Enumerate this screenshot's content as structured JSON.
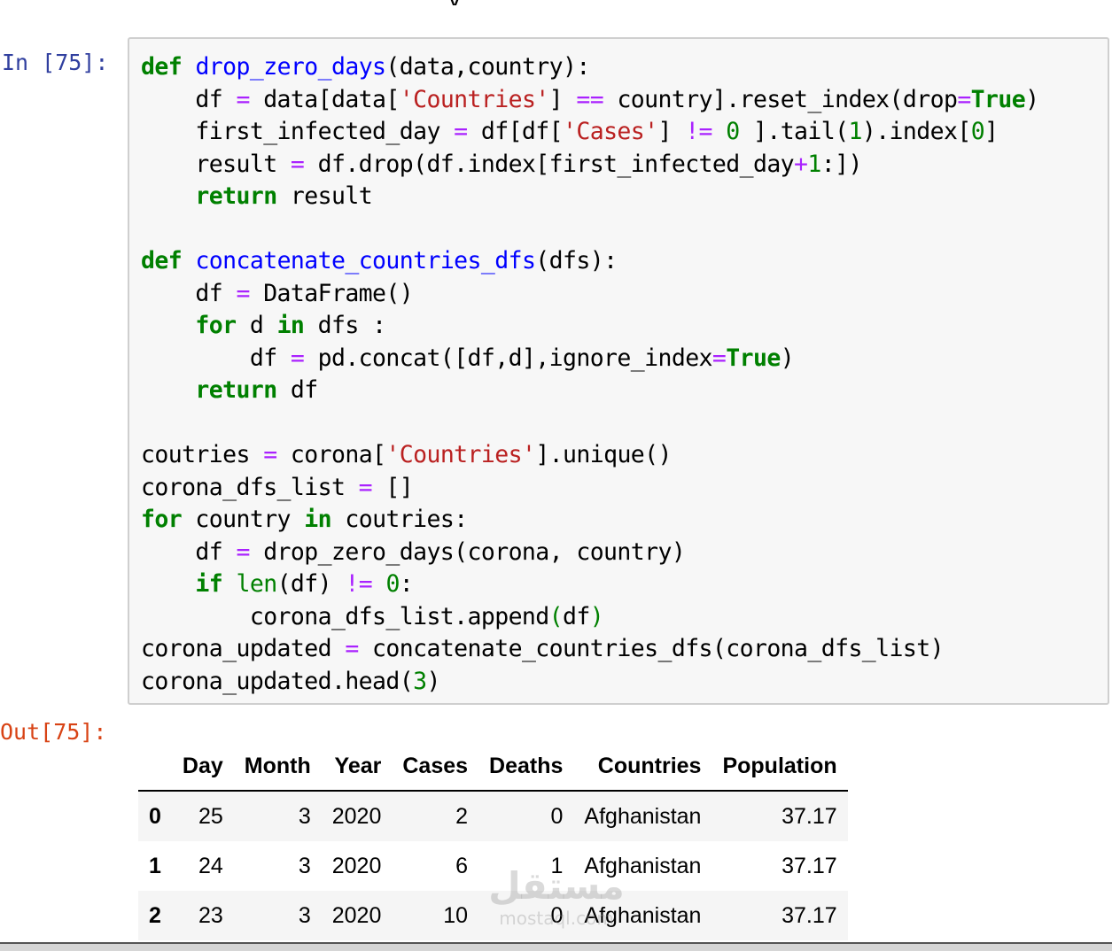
{
  "input_prompt": "In [75]:",
  "output_prompt": "Out[75]:",
  "code_lines": [
    [
      [
        "kw",
        "def"
      ],
      [
        "t",
        " "
      ],
      [
        "fn",
        "drop_zero_days"
      ],
      [
        "t",
        "(data,country):"
      ]
    ],
    [
      [
        "t",
        "    df "
      ],
      [
        "op",
        "="
      ],
      [
        "t",
        " data[data["
      ],
      [
        "str",
        "'Countries'"
      ],
      [
        "t",
        "] "
      ],
      [
        "op",
        "=="
      ],
      [
        "t",
        " country].reset_index(drop"
      ],
      [
        "op",
        "="
      ],
      [
        "kw",
        "True"
      ],
      [
        "t",
        ")"
      ]
    ],
    [
      [
        "t",
        "    first_infected_day "
      ],
      [
        "op",
        "="
      ],
      [
        "t",
        " df[df["
      ],
      [
        "str",
        "'Cases'"
      ],
      [
        "t",
        "] "
      ],
      [
        "op",
        "!="
      ],
      [
        "t",
        " "
      ],
      [
        "num",
        "0"
      ],
      [
        "t",
        " ].tail("
      ],
      [
        "num",
        "1"
      ],
      [
        "t",
        ").index["
      ],
      [
        "num",
        "0"
      ],
      [
        "t",
        "]"
      ]
    ],
    [
      [
        "t",
        "    result "
      ],
      [
        "op",
        "="
      ],
      [
        "t",
        " df.drop(df.index[first_infected_day"
      ],
      [
        "op",
        "+"
      ],
      [
        "num",
        "1"
      ],
      [
        "t",
        ":])"
      ]
    ],
    [
      [
        "t",
        "    "
      ],
      [
        "kw",
        "return"
      ],
      [
        "t",
        " result"
      ]
    ],
    [
      [
        "t",
        ""
      ]
    ],
    [
      [
        "kw",
        "def"
      ],
      [
        "t",
        " "
      ],
      [
        "fn",
        "concatenate_countries_dfs"
      ],
      [
        "t",
        "(dfs):"
      ]
    ],
    [
      [
        "t",
        "    df "
      ],
      [
        "op",
        "="
      ],
      [
        "t",
        " DataFrame()"
      ]
    ],
    [
      [
        "t",
        "    "
      ],
      [
        "kw",
        "for"
      ],
      [
        "t",
        " d "
      ],
      [
        "kw",
        "in"
      ],
      [
        "t",
        " dfs :"
      ]
    ],
    [
      [
        "t",
        "        df "
      ],
      [
        "op",
        "="
      ],
      [
        "t",
        " pd.concat([df,d],ignore_index"
      ],
      [
        "op",
        "="
      ],
      [
        "kw",
        "True"
      ],
      [
        "t",
        ")"
      ]
    ],
    [
      [
        "t",
        "    "
      ],
      [
        "kw",
        "return"
      ],
      [
        "t",
        " df"
      ]
    ],
    [
      [
        "t",
        ""
      ]
    ],
    [
      [
        "t",
        "coutries "
      ],
      [
        "op",
        "="
      ],
      [
        "t",
        " corona["
      ],
      [
        "str",
        "'Countries'"
      ],
      [
        "t",
        "].unique()"
      ]
    ],
    [
      [
        "t",
        "corona_dfs_list "
      ],
      [
        "op",
        "="
      ],
      [
        "t",
        " []"
      ]
    ],
    [
      [
        "kw",
        "for"
      ],
      [
        "t",
        " country "
      ],
      [
        "kw",
        "in"
      ],
      [
        "t",
        " coutries:"
      ]
    ],
    [
      [
        "t",
        "    df "
      ],
      [
        "op",
        "="
      ],
      [
        "t",
        " drop_zero_days(corona, country)"
      ]
    ],
    [
      [
        "t",
        "    "
      ],
      [
        "kw",
        "if"
      ],
      [
        "t",
        " "
      ],
      [
        "bi",
        "len"
      ],
      [
        "t",
        "(df) "
      ],
      [
        "op",
        "!="
      ],
      [
        "t",
        " "
      ],
      [
        "num",
        "0"
      ],
      [
        "t",
        ":"
      ]
    ],
    [
      [
        "t",
        "        corona_dfs_list.append"
      ],
      [
        "num",
        "("
      ],
      [
        "t",
        "df"
      ],
      [
        "num",
        ")"
      ]
    ],
    [
      [
        "t",
        "corona_updated "
      ],
      [
        "op",
        "="
      ],
      [
        "t",
        " concatenate_countries_dfs(corona_dfs_list)"
      ]
    ],
    [
      [
        "t",
        "corona_updated.head("
      ],
      [
        "num",
        "3"
      ],
      [
        "t",
        ")"
      ]
    ]
  ],
  "output_table": {
    "columns": [
      "",
      "Day",
      "Month",
      "Year",
      "Cases",
      "Deaths",
      "Countries",
      "Population"
    ],
    "rows": [
      [
        "0",
        "25",
        "3",
        "2020",
        "2",
        "0",
        "Afghanistan",
        "37.17"
      ],
      [
        "1",
        "24",
        "3",
        "2020",
        "6",
        "1",
        "Afghanistan",
        "37.17"
      ],
      [
        "2",
        "23",
        "3",
        "2020",
        "10",
        "0",
        "Afghanistan",
        "37.17"
      ]
    ]
  },
  "watermark": {
    "arabic": "مستقل",
    "latin": "mostaql.com"
  }
}
